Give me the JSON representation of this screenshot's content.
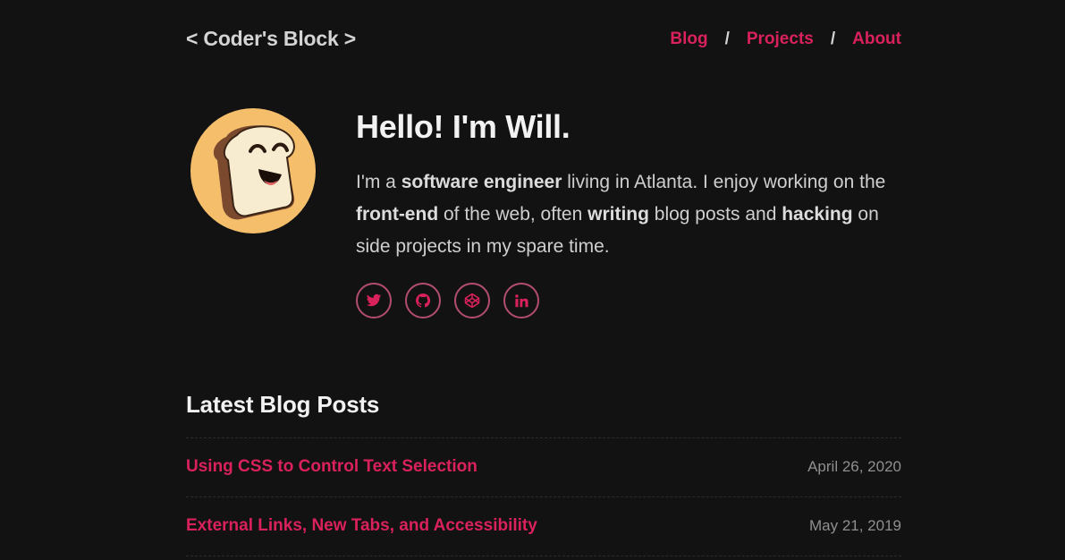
{
  "header": {
    "logo": "< Coder's Block >",
    "nav": [
      {
        "label": "Blog"
      },
      {
        "label": "Projects"
      },
      {
        "label": "About"
      }
    ],
    "separator": "/"
  },
  "hero": {
    "avatar_icon": "smiling-toast-icon",
    "title": "Hello! I'm Will.",
    "intro": {
      "p1": "I'm a ",
      "b1": "software engineer",
      "p2": " living in Atlanta. I enjoy working on the ",
      "b2": "front-end",
      "p3": " of the web, often ",
      "b3": "writing",
      "p4": " blog posts and ",
      "b4": "hacking",
      "p5": " on side projects in my spare time."
    },
    "social": [
      {
        "icon": "twitter-icon"
      },
      {
        "icon": "github-icon"
      },
      {
        "icon": "codepen-icon"
      },
      {
        "icon": "linkedin-icon"
      }
    ]
  },
  "blog": {
    "title": "Latest Blog Posts",
    "posts": [
      {
        "title": "Using CSS to Control Text Selection",
        "date": "April 26, 2020"
      },
      {
        "title": "External Links, New Tabs, and Accessibility",
        "date": "May 21, 2019"
      }
    ]
  },
  "colors": {
    "background": "#121212",
    "accent": "#d9215c",
    "text": "#cfcfcf",
    "heading": "#f2f2f2",
    "avatar_bg": "#f4be6b"
  }
}
